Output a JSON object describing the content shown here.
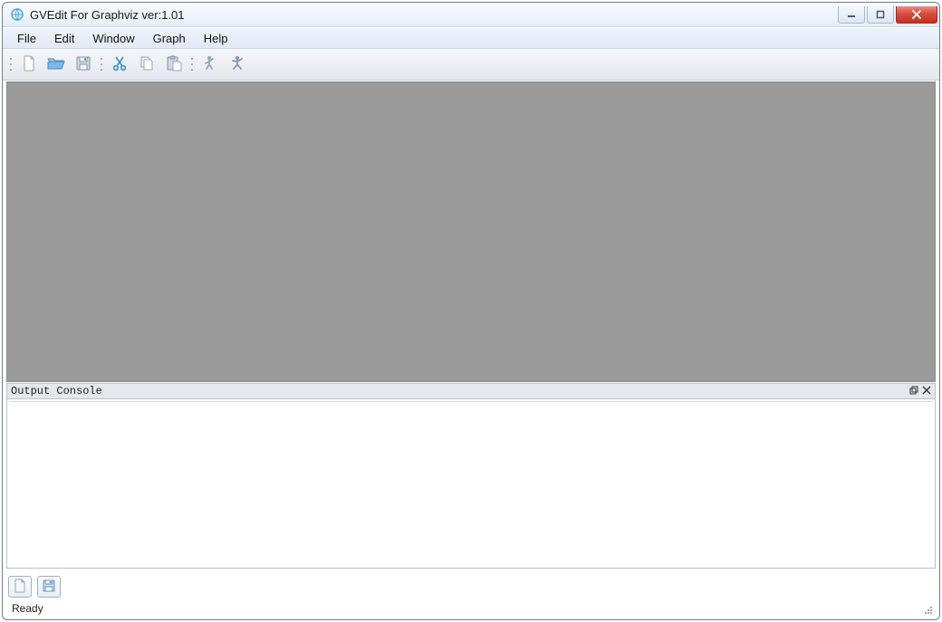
{
  "window": {
    "title": "GVEdit For Graphviz ver:1.01"
  },
  "menubar": {
    "items": [
      "File",
      "Edit",
      "Window",
      "Graph",
      "Help"
    ]
  },
  "toolbar": {
    "icons": [
      "new-file-icon",
      "open-folder-icon",
      "save-icon",
      "cut-icon",
      "copy-icon",
      "paste-icon",
      "run-icon",
      "run-man-icon"
    ]
  },
  "console": {
    "title": "Output Console"
  },
  "status": {
    "text": "Ready"
  }
}
